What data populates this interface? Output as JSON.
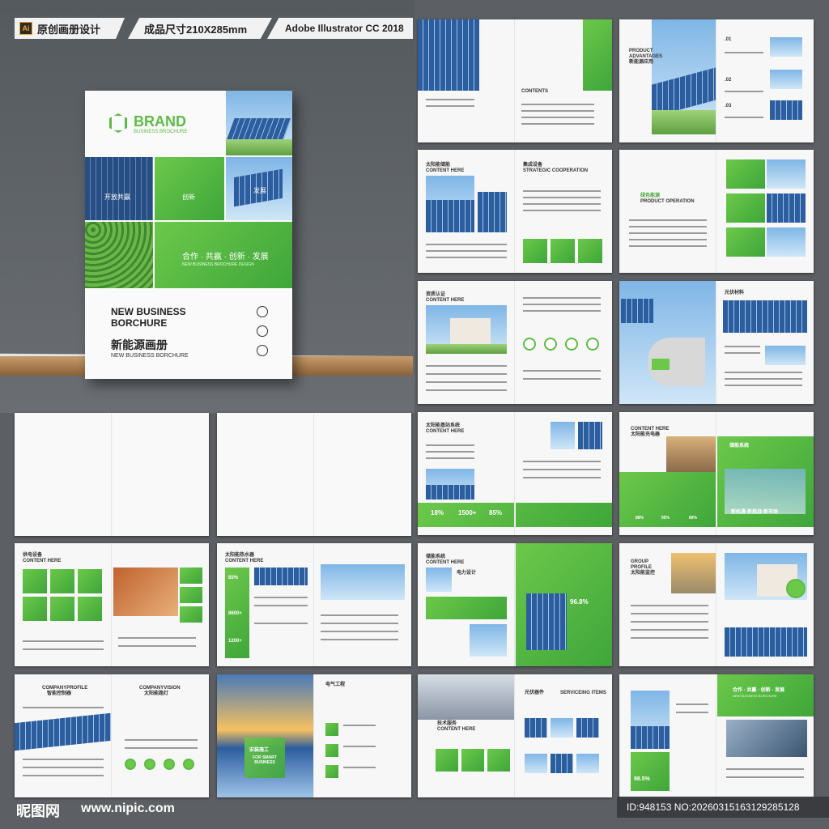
{
  "header": {
    "app_icon": "Ai",
    "tag1": "原创画册设计",
    "tag2": "成品尺寸210X285mm",
    "tag3": "Adobe Illustrator CC 2018"
  },
  "cover": {
    "brand": "BRAND",
    "brand_sub": "BUSINESS BROCHURE",
    "tile1": "开放共赢",
    "tile2": "创新",
    "tile3": "发展",
    "slogan": "合作 · 共赢 · 创新 · 发展",
    "slogan_sub": "NEW BUSINESS BROCHURE DESIGN",
    "title_en_1": "NEW BUSINESS",
    "title_en_2": "BORCHURE",
    "title_cn": "新能源画册",
    "title_en_small": "NEW BUSINESS BORCHURE"
  },
  "spreads": {
    "s1": {
      "contents": "CONTENTS"
    },
    "s2": {
      "title1": "PRODUCT",
      "title2": "ADVANTAGES",
      "title_cn": "新能源应用",
      "n1": ".01",
      "n2": ".02",
      "n3": ".03"
    },
    "s3": {
      "title": "太阳能储能",
      "sub": "CONTENT HERE",
      "right_title": "集成设备",
      "right_sub": "STRATEGIC COOPERATION"
    },
    "s4": {
      "title": "绿色能源",
      "sub": "PRODUCT OPERATION"
    },
    "s5": {
      "title": "资质认证",
      "sub": "CONTENT HERE"
    },
    "s6": {
      "title": "光伏材料"
    },
    "s7": {
      "title": "太阳能基站系统",
      "sub": "CONTENT HERE",
      "stat1": "18%",
      "stat2": "1500+",
      "stat3": "85%"
    },
    "s8": {
      "title": "CONTENT HERE",
      "title_cn": "太阳能充电器",
      "banner": "储能系统",
      "slogan": "新机遇·新挑战·新市场",
      "stat1": "88%",
      "stat2": "95%",
      "stat3": "89%"
    },
    "s9": {
      "title": "供电设备",
      "sub": "CONTENT HERE"
    },
    "s10": {
      "title": "太阳能热水器",
      "sub": "CONTENT HERE",
      "stat1": "85%",
      "stat2": "8600+",
      "stat3": "1200+"
    },
    "s11": {
      "title": "储能系统",
      "sub": "CONTENT HERE",
      "right_title": "电力设计",
      "stat": "96.8%"
    },
    "s12": {
      "title1": "GROUP",
      "title2": "PROFILE",
      "title_cn": "太阳能监控"
    },
    "s13": {
      "title1": "COMPANYPROFILE",
      "title_cn": "智能控制器",
      "right_title": "COMPANYVISION",
      "right_cn": "太阳能路灯"
    },
    "s14": {
      "overlay_cn": "安装施工",
      "overlay_en": "FOR SMART BUSINESS",
      "right_title": "电气工程"
    },
    "s15": {
      "title": "技术服务",
      "sub": "CONTENT HERE",
      "right_title": "光伏器件",
      "right_sub": "SERVICEING ITEMS"
    },
    "s16": {
      "slogan": "合作 · 共赢 · 创新 · 发展",
      "slogan_en": "NEW BUSINESS BORCHURE",
      "stat": "98.5%"
    }
  },
  "footer": {
    "watermark_cn": "昵图网",
    "watermark_url": "www.nipic.com",
    "id_text": "ID:948153 NO:20260315163129285128"
  },
  "colors": {
    "accent": "#5cbc44",
    "background": "#5c5f63"
  }
}
